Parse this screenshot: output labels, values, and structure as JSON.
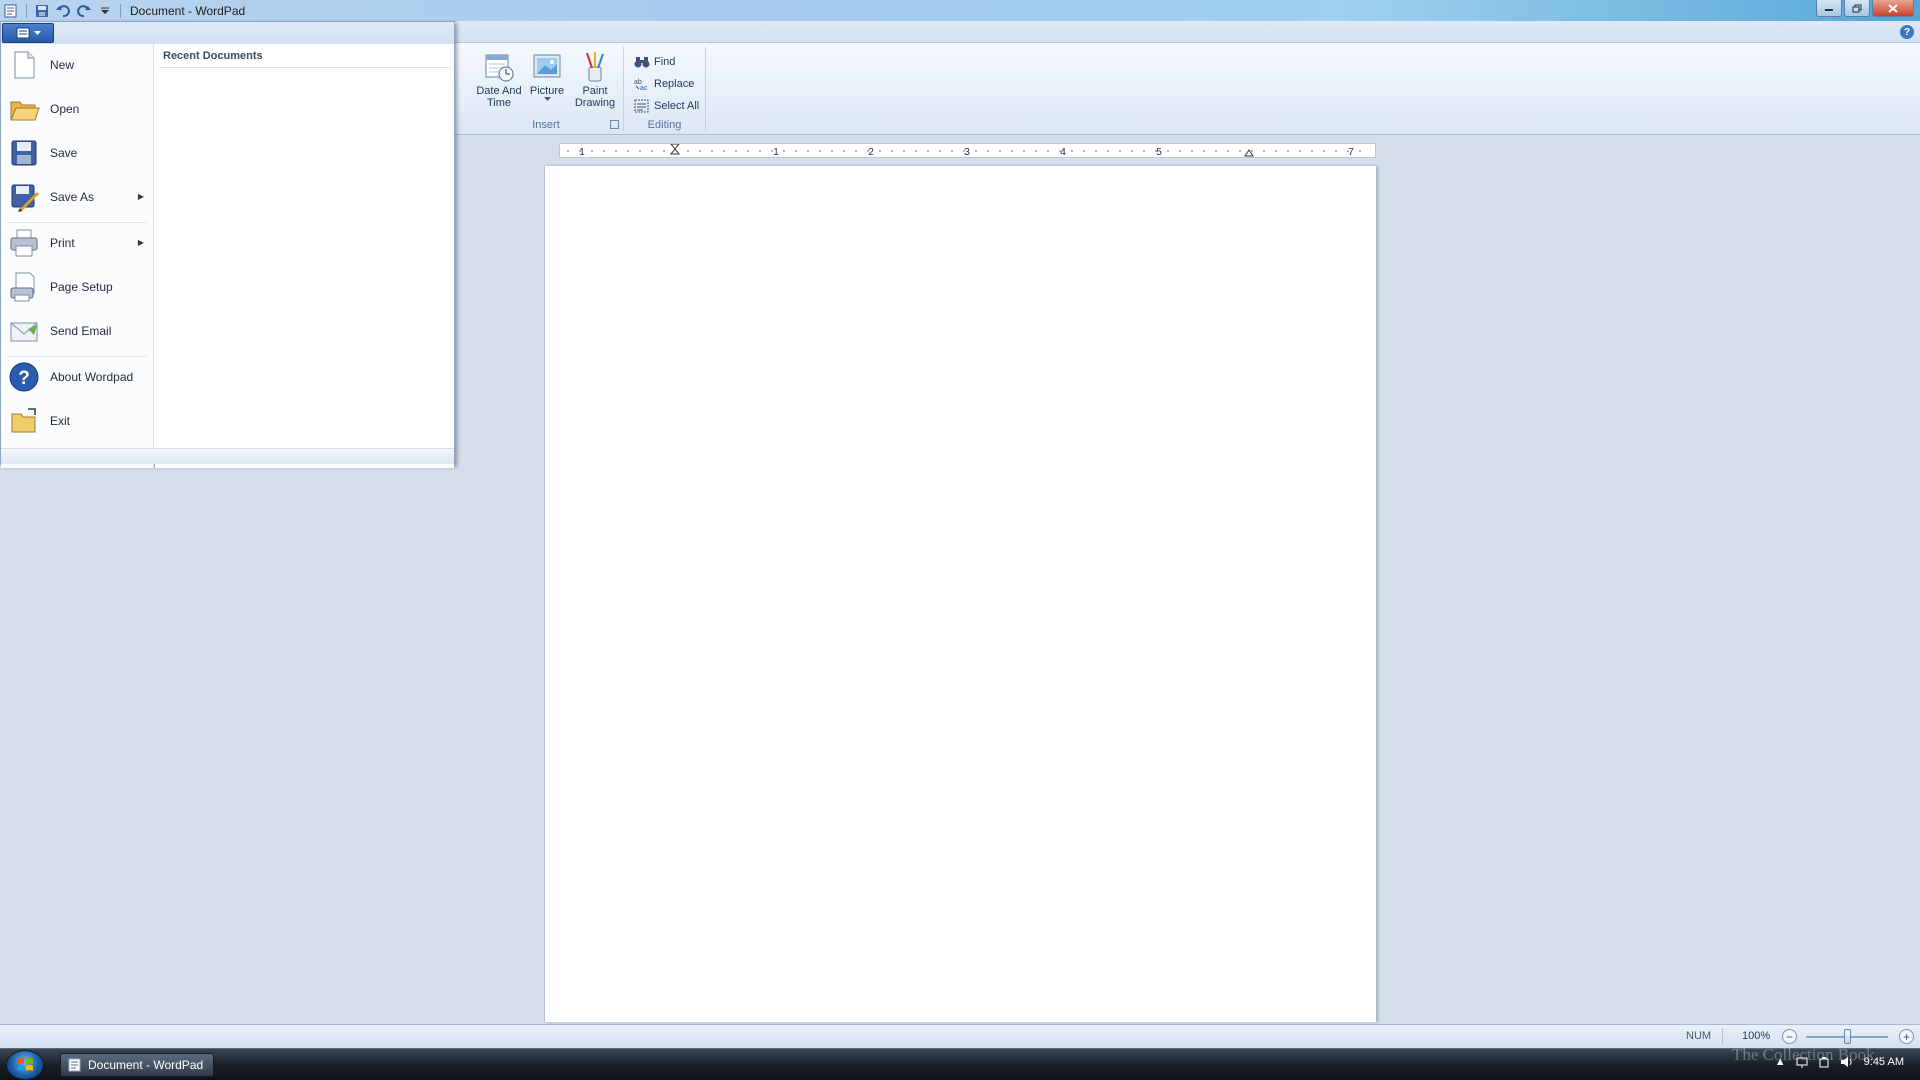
{
  "window": {
    "title": "Document - WordPad",
    "controls": [
      "minimize",
      "restore",
      "close"
    ]
  },
  "qat": [
    "save-icon",
    "undo-icon",
    "redo-icon",
    "customize-icon"
  ],
  "app_menu": {
    "items": [
      {
        "label": "New",
        "icon": "new-document-icon"
      },
      {
        "label": "Open",
        "icon": "open-folder-icon"
      },
      {
        "label": "Save",
        "icon": "save-disk-icon"
      },
      {
        "label": "Save As",
        "icon": "save-as-icon",
        "submenu": true
      },
      {
        "label": "Print",
        "icon": "printer-icon",
        "submenu": true
      },
      {
        "label": "Page Setup",
        "icon": "page-setup-icon"
      },
      {
        "label": "Send Email",
        "icon": "email-icon"
      },
      {
        "label": "About Wordpad",
        "icon": "help-question-icon"
      },
      {
        "label": "Exit",
        "icon": "exit-folder-icon"
      }
    ],
    "recent_title": "Recent Documents"
  },
  "ribbon": {
    "insert": {
      "label": "Insert",
      "date_time": "Date And Time",
      "picture": "Picture",
      "paint_drawing": "Paint Drawing"
    },
    "editing": {
      "label": "Editing",
      "find": "Find",
      "replace": "Replace",
      "select_all": "Select All"
    }
  },
  "ruler": {
    "labels": [
      "1",
      "1",
      "2",
      "3",
      "4",
      "5",
      "7"
    ]
  },
  "status": {
    "num": "NUM",
    "zoom": "100%",
    "zoom_minus": "−",
    "zoom_plus": "+"
  },
  "taskbar": {
    "task": "Document - WordPad",
    "time": "9:45 AM"
  },
  "watermark": "The Collection Book",
  "colors": {
    "accent": "#2a5aa8",
    "ribbon_bg": "#dce7f5",
    "workspace": "#d5dfec",
    "taskbar": "#1a2028"
  }
}
